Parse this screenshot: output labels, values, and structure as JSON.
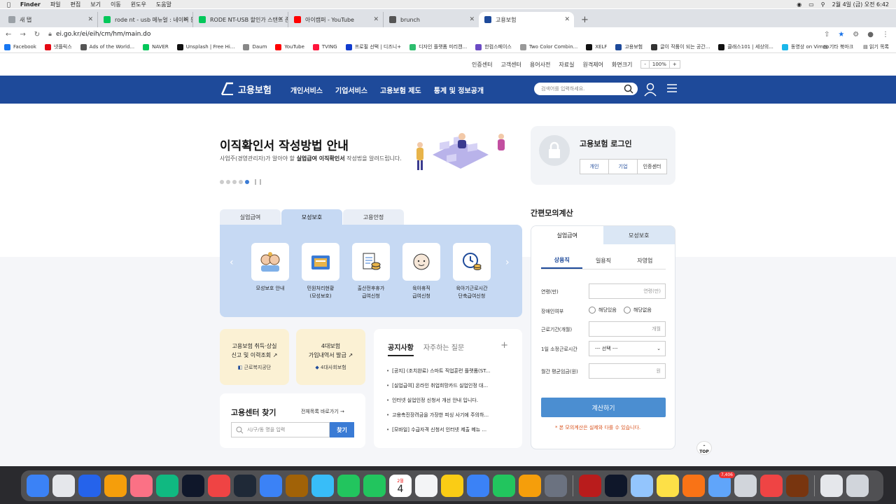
{
  "menubar": {
    "apple": "",
    "items": [
      "Finder",
      "파일",
      "편집",
      "보기",
      "이동",
      "윈도우",
      "도움말"
    ],
    "clock": "2월 4일 (금) 오전 6:42"
  },
  "tabs": [
    {
      "label": "새 탭",
      "color": "#9aa0a6"
    },
    {
      "label": "rode nt - usb 메뉴얼 : 네이버 통합",
      "color": "#03c75a"
    },
    {
      "label": "RODE NT-USB 할인가 스탠드 존문",
      "color": "#03c75a"
    },
    {
      "label": "아이캠퍼 - YouTube",
      "color": "#ff0000"
    },
    {
      "label": "brunch",
      "color": "#555555"
    },
    {
      "label": "고용보험",
      "color": "#1e4a9a"
    }
  ],
  "address": {
    "url": "ei.go.kr/ei/eih/cm/hm/main.do"
  },
  "bookmarks": [
    {
      "label": "Facebook",
      "color": "#1877f2"
    },
    {
      "label": "넷플릭스",
      "color": "#e50914"
    },
    {
      "label": "Ads of the World...",
      "color": "#555"
    },
    {
      "label": "NAVER",
      "color": "#03c75a"
    },
    {
      "label": "Unsplash | Free Hi...",
      "color": "#111"
    },
    {
      "label": "Daum",
      "color": "#888"
    },
    {
      "label": "YouTube",
      "color": "#ff0000"
    },
    {
      "label": "TVING",
      "color": "#ff153c"
    },
    {
      "label": "프로필 선택 | 디즈니+",
      "color": "#113ccf"
    },
    {
      "label": "디자인 플랫폼 미리캔...",
      "color": "#2dbd6e"
    },
    {
      "label": "한컴스페이스",
      "color": "#6b4bc4"
    },
    {
      "label": "Two Color Combin...",
      "color": "#999"
    },
    {
      "label": "XELF",
      "color": "#111"
    },
    {
      "label": "고용보험",
      "color": "#1e4a9a"
    },
    {
      "label": "글이 작품이 되는 공간...",
      "color": "#333"
    },
    {
      "label": "클래스101 | 세상의...",
      "color": "#111"
    },
    {
      "label": "동영상 on Vimeo",
      "color": "#1ab7ea"
    }
  ],
  "bookmarks_right": [
    "기타 북마크",
    "읽기 목록"
  ],
  "utility": {
    "links": [
      "인증센터",
      "고객센터",
      "용어사전",
      "자료실",
      "원격제어",
      "화면크기"
    ],
    "zoom_minus": "-",
    "zoom_value": "100%",
    "zoom_plus": "+"
  },
  "gnb": {
    "logo": "고용보험",
    "menu": [
      "개인서비스",
      "기업서비스",
      "고용보험 제도",
      "통계 및 정보공개"
    ],
    "search_placeholder": "검색어를 입력하세요."
  },
  "banner": {
    "title": "이직확인서 작성방법 안내",
    "sub_pre": "사업주(경영관리자)가 알아야 할 ",
    "sub_bold": "실업급여 이직확인서",
    "sub_post": " 작성법을 알려드립니다.",
    "dots": 5,
    "active_dot": 5
  },
  "login": {
    "title": "고용보험 로그인",
    "buttons": [
      "개인",
      "기업",
      "인증센터"
    ]
  },
  "main_tabs": {
    "items": [
      "실업급여",
      "모성보호",
      "고용안정"
    ],
    "active": 1
  },
  "services": [
    {
      "line1": "모성보호 안내",
      "line2": "",
      "icon": "family-icon"
    },
    {
      "line1": "민원처리현황",
      "line2": "(모성보호)",
      "icon": "folder-icon"
    },
    {
      "line1": "출산전후휴가",
      "line2": "급여신청",
      "icon": "document-coin-icon"
    },
    {
      "line1": "육아휴직",
      "line2": "급여신청",
      "icon": "baby-icon"
    },
    {
      "line1": "육아기근로시간",
      "line2": "단축급여신청",
      "icon": "clock-coin-icon"
    }
  ],
  "quick": [
    {
      "line1": "고용보험 취득·상실",
      "line2": "신고 및 이력조회",
      "org": "근로복지공단"
    },
    {
      "line1": "4대보험",
      "line2": "가입내역서 발급",
      "org": "4대사회보험"
    }
  ],
  "center": {
    "title": "고용센터 찾기",
    "link": "전체목록 바로가기",
    "placeholder": "시/구/동 명을 입력",
    "button": "찾기"
  },
  "notice": {
    "tab_on": "공지사항",
    "tab_off": "자주하는 질문",
    "plus": "+",
    "items": [
      "[공지] (조치완료) 스마트 직업훈련 플랫폼(ST...",
      "[실업급여] 온라인 취업희망카드 실업인정 대...",
      "인터넷 실업인정 신청서 개선 안내 입니다.",
      "고용촉진장려금을 가장한 피싱 사기에 주의하...",
      "[모바일] 수급자격 신청서 인터넷 제출 메뉴 ..."
    ]
  },
  "calc": {
    "title": "간편모의계산",
    "tabs": [
      "실업급여",
      "모성보호"
    ],
    "subtabs": [
      "상용직",
      "일용직",
      "자영업"
    ],
    "age_label": "연령(만)",
    "age_unit": "연령(만)",
    "disabled_label": "장애인여부",
    "radio_yes": "해당있음",
    "radio_no": "해당없음",
    "period_label": "근로기간(개월)",
    "period_unit": "개월",
    "hours_label": "1일 소정근로시간",
    "hours_select": "--- 선택 ---",
    "wage_label": "월간 평균임금(원)",
    "wage_unit": "원",
    "button": "계산하기",
    "note": "* 본 모의계산은 실제와 다를 수 있습니다."
  },
  "top_button": "TOP",
  "dock": {
    "apps": [
      "#3b82f6",
      "#e5e7eb",
      "#2563eb",
      "#f59e0b",
      "#fb7185",
      "#10b981",
      "#0f172a",
      "#ef4444",
      "#1f2937",
      "#3b82f6",
      "#a16207",
      "#38bdf8",
      "#22c55e",
      "#22c55e",
      "#ffffff",
      "#f3f4f6",
      "#facc15",
      "#3b82f6",
      "#22c55e",
      "#f59e0b",
      "#6b7280"
    ],
    "apps2": [
      "#b91c1c",
      "#0f172a",
      "#93c5fd",
      "#fde047",
      "#f97316",
      "#60a5fa",
      "#d1d5db",
      "#ef4444",
      "#78350f"
    ],
    "calendar_month": "2월",
    "calendar_day": "4",
    "mail_badge": "7,406"
  }
}
